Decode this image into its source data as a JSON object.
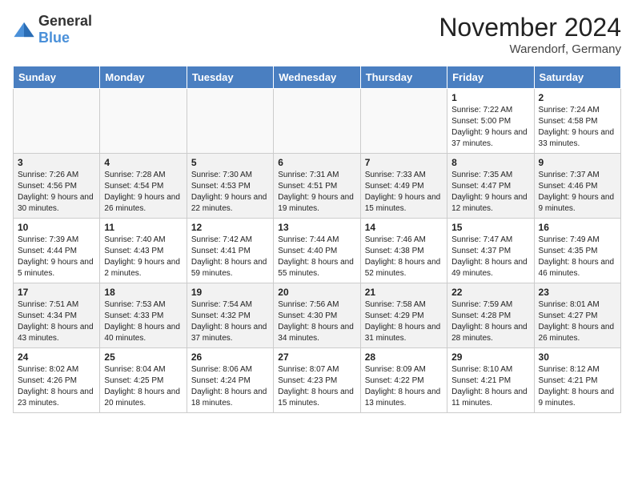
{
  "header": {
    "logo_general": "General",
    "logo_blue": "Blue",
    "title": "November 2024",
    "location": "Warendorf, Germany"
  },
  "weekdays": [
    "Sunday",
    "Monday",
    "Tuesday",
    "Wednesday",
    "Thursday",
    "Friday",
    "Saturday"
  ],
  "weeks": [
    [
      {
        "day": "",
        "info": ""
      },
      {
        "day": "",
        "info": ""
      },
      {
        "day": "",
        "info": ""
      },
      {
        "day": "",
        "info": ""
      },
      {
        "day": "",
        "info": ""
      },
      {
        "day": "1",
        "info": "Sunrise: 7:22 AM\nSunset: 5:00 PM\nDaylight: 9 hours and 37 minutes."
      },
      {
        "day": "2",
        "info": "Sunrise: 7:24 AM\nSunset: 4:58 PM\nDaylight: 9 hours and 33 minutes."
      }
    ],
    [
      {
        "day": "3",
        "info": "Sunrise: 7:26 AM\nSunset: 4:56 PM\nDaylight: 9 hours and 30 minutes."
      },
      {
        "day": "4",
        "info": "Sunrise: 7:28 AM\nSunset: 4:54 PM\nDaylight: 9 hours and 26 minutes."
      },
      {
        "day": "5",
        "info": "Sunrise: 7:30 AM\nSunset: 4:53 PM\nDaylight: 9 hours and 22 minutes."
      },
      {
        "day": "6",
        "info": "Sunrise: 7:31 AM\nSunset: 4:51 PM\nDaylight: 9 hours and 19 minutes."
      },
      {
        "day": "7",
        "info": "Sunrise: 7:33 AM\nSunset: 4:49 PM\nDaylight: 9 hours and 15 minutes."
      },
      {
        "day": "8",
        "info": "Sunrise: 7:35 AM\nSunset: 4:47 PM\nDaylight: 9 hours and 12 minutes."
      },
      {
        "day": "9",
        "info": "Sunrise: 7:37 AM\nSunset: 4:46 PM\nDaylight: 9 hours and 9 minutes."
      }
    ],
    [
      {
        "day": "10",
        "info": "Sunrise: 7:39 AM\nSunset: 4:44 PM\nDaylight: 9 hours and 5 minutes."
      },
      {
        "day": "11",
        "info": "Sunrise: 7:40 AM\nSunset: 4:43 PM\nDaylight: 9 hours and 2 minutes."
      },
      {
        "day": "12",
        "info": "Sunrise: 7:42 AM\nSunset: 4:41 PM\nDaylight: 8 hours and 59 minutes."
      },
      {
        "day": "13",
        "info": "Sunrise: 7:44 AM\nSunset: 4:40 PM\nDaylight: 8 hours and 55 minutes."
      },
      {
        "day": "14",
        "info": "Sunrise: 7:46 AM\nSunset: 4:38 PM\nDaylight: 8 hours and 52 minutes."
      },
      {
        "day": "15",
        "info": "Sunrise: 7:47 AM\nSunset: 4:37 PM\nDaylight: 8 hours and 49 minutes."
      },
      {
        "day": "16",
        "info": "Sunrise: 7:49 AM\nSunset: 4:35 PM\nDaylight: 8 hours and 46 minutes."
      }
    ],
    [
      {
        "day": "17",
        "info": "Sunrise: 7:51 AM\nSunset: 4:34 PM\nDaylight: 8 hours and 43 minutes."
      },
      {
        "day": "18",
        "info": "Sunrise: 7:53 AM\nSunset: 4:33 PM\nDaylight: 8 hours and 40 minutes."
      },
      {
        "day": "19",
        "info": "Sunrise: 7:54 AM\nSunset: 4:32 PM\nDaylight: 8 hours and 37 minutes."
      },
      {
        "day": "20",
        "info": "Sunrise: 7:56 AM\nSunset: 4:30 PM\nDaylight: 8 hours and 34 minutes."
      },
      {
        "day": "21",
        "info": "Sunrise: 7:58 AM\nSunset: 4:29 PM\nDaylight: 8 hours and 31 minutes."
      },
      {
        "day": "22",
        "info": "Sunrise: 7:59 AM\nSunset: 4:28 PM\nDaylight: 8 hours and 28 minutes."
      },
      {
        "day": "23",
        "info": "Sunrise: 8:01 AM\nSunset: 4:27 PM\nDaylight: 8 hours and 26 minutes."
      }
    ],
    [
      {
        "day": "24",
        "info": "Sunrise: 8:02 AM\nSunset: 4:26 PM\nDaylight: 8 hours and 23 minutes."
      },
      {
        "day": "25",
        "info": "Sunrise: 8:04 AM\nSunset: 4:25 PM\nDaylight: 8 hours and 20 minutes."
      },
      {
        "day": "26",
        "info": "Sunrise: 8:06 AM\nSunset: 4:24 PM\nDaylight: 8 hours and 18 minutes."
      },
      {
        "day": "27",
        "info": "Sunrise: 8:07 AM\nSunset: 4:23 PM\nDaylight: 8 hours and 15 minutes."
      },
      {
        "day": "28",
        "info": "Sunrise: 8:09 AM\nSunset: 4:22 PM\nDaylight: 8 hours and 13 minutes."
      },
      {
        "day": "29",
        "info": "Sunrise: 8:10 AM\nSunset: 4:21 PM\nDaylight: 8 hours and 11 minutes."
      },
      {
        "day": "30",
        "info": "Sunrise: 8:12 AM\nSunset: 4:21 PM\nDaylight: 8 hours and 9 minutes."
      }
    ]
  ]
}
